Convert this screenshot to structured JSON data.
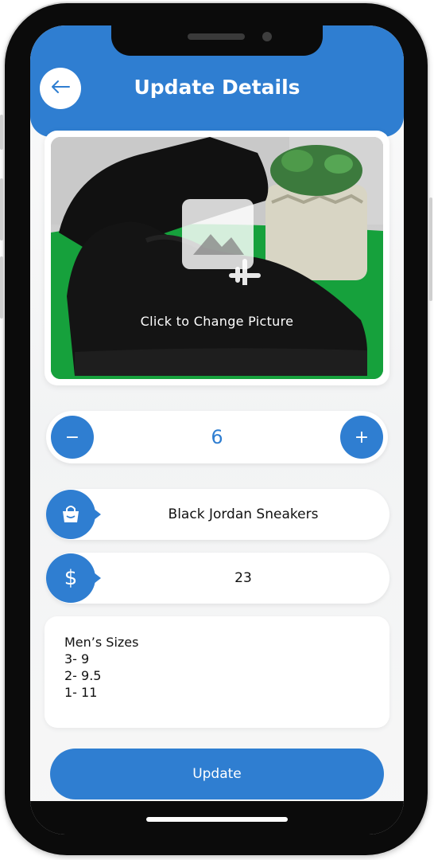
{
  "header": {
    "title": "Update Details"
  },
  "photo": {
    "change_label": "Click to Change Picture"
  },
  "quantity": {
    "value": "6",
    "minus_symbol": "−",
    "plus_symbol": "+"
  },
  "product": {
    "name": "Black Jordan Sneakers",
    "price": "23",
    "currency_symbol": "$"
  },
  "notes": {
    "text": "Men’s Sizes\n3- 9\n2- 9.5\n1- 11"
  },
  "actions": {
    "update_label": "Update"
  },
  "icons": {
    "back": "arrow-left-icon",
    "add_image": "add-image-icon",
    "bag": "shopping-bag-icon"
  },
  "colors": {
    "accent": "#2f7ed1"
  }
}
